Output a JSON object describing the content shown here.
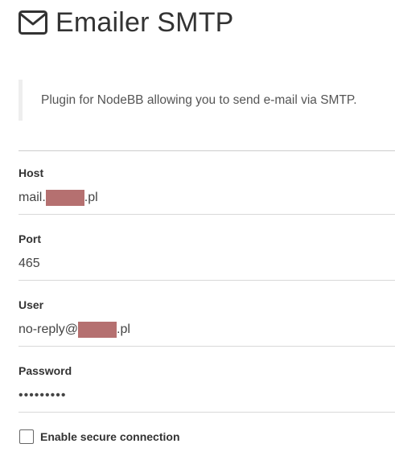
{
  "header": {
    "title": "Emailer SMTP",
    "icon": "envelope-icon"
  },
  "description": "Plugin for NodeBB allowing you to send e-mail via SMTP.",
  "fields": {
    "host": {
      "label": "Host",
      "value_prefix": "mail.",
      "value_suffix": ".pl"
    },
    "port": {
      "label": "Port",
      "value": "465"
    },
    "user": {
      "label": "User",
      "value_prefix": "no-reply@",
      "value_suffix": ".pl"
    },
    "password": {
      "label": "Password",
      "value": "•••••••••"
    }
  },
  "secure": {
    "label": "Enable secure connection",
    "checked": false
  },
  "colors": {
    "redaction": "#b57070",
    "divider": "#cccccc"
  }
}
